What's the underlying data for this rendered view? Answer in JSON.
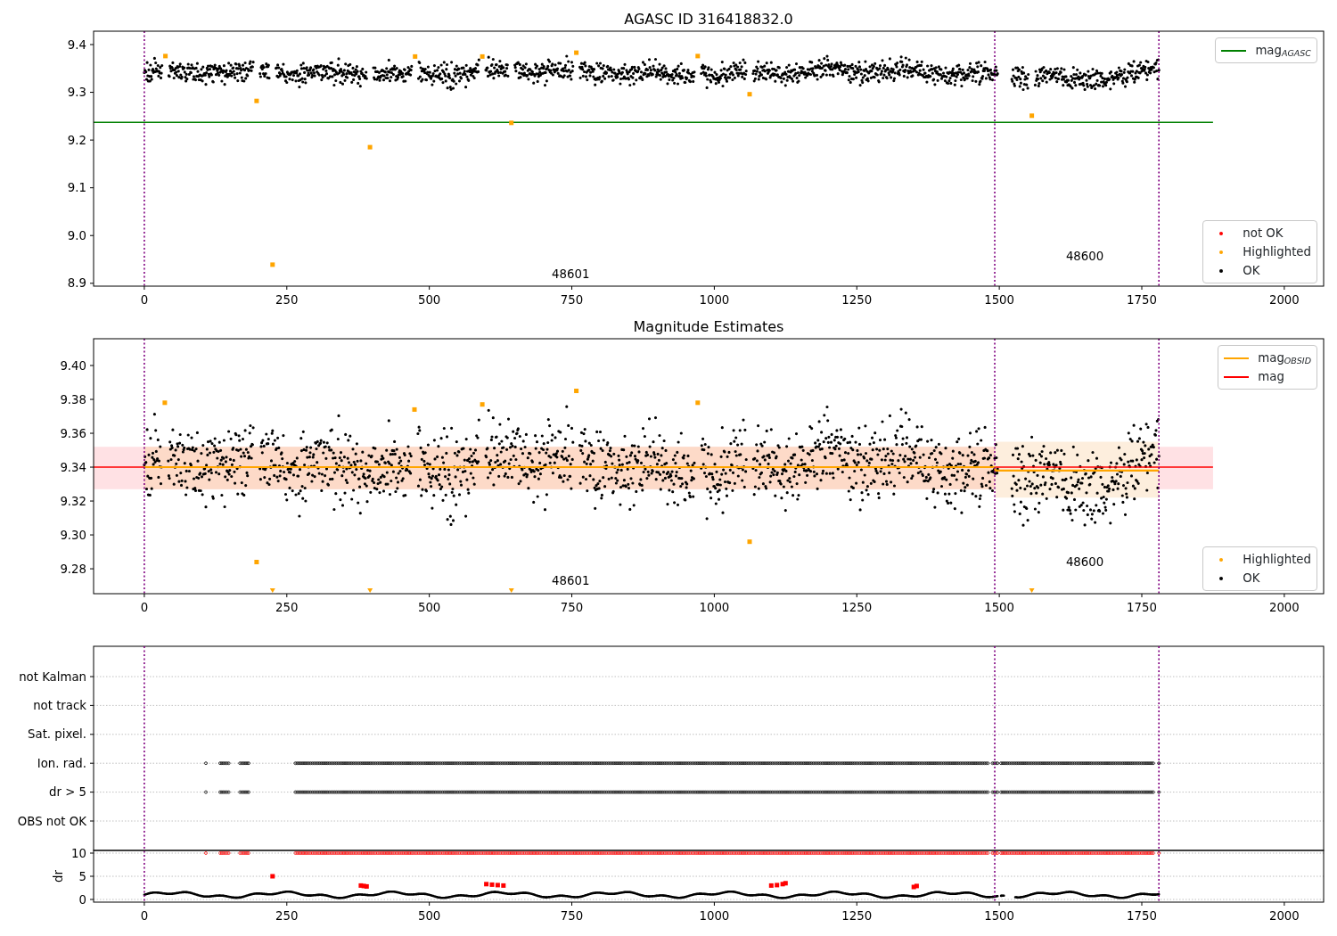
{
  "charts": [
    {
      "kind": "magnitude",
      "chart_data": {
        "type": "scatter",
        "title": "AGASC ID 316418832.0",
        "xlim": [
          -89,
          2069
        ],
        "ylim": [
          8.894,
          9.428
        ],
        "xticks": [
          0,
          250,
          500,
          750,
          1000,
          1250,
          1500,
          1750,
          2000
        ],
        "yticks": [
          {
            "value": 8.9,
            "label": "8.9"
          },
          {
            "value": 9.0,
            "label": "9.0"
          },
          {
            "value": 9.1,
            "label": "9.1"
          },
          {
            "value": 9.2,
            "label": "9.2"
          },
          {
            "value": 9.3,
            "label": "9.3"
          },
          {
            "value": 9.4,
            "label": "9.4"
          }
        ],
        "x": [
          -89,
          37,
          197,
          225,
          396,
          475,
          593,
          644,
          758,
          971,
          1062,
          1557,
          1875
        ],
        "series": [
          {
            "type": "line",
            "color": "#008000",
            "values": [
              9.237,
              9.237,
              9.237,
              9.237,
              9.237,
              9.237,
              9.237,
              9.237,
              9.237,
              9.237,
              9.237,
              9.237,
              9.237
            ]
          },
          {
            "color": "#ffa500",
            "values": [
              null,
              9.376,
              9.282,
              8.939,
              9.185,
              9.375,
              9.375,
              9.236,
              9.383,
              9.376,
              9.296,
              9.251,
              null
            ]
          }
        ],
        "ref_lines": [
          {
            "axis": "x",
            "value": 0,
            "color": "#800080"
          },
          {
            "axis": "x",
            "value": 1492,
            "color": "#800080"
          },
          {
            "axis": "x",
            "value": 1780,
            "color": "#800080"
          }
        ],
        "annotations": [
          "48601",
          "48600"
        ]
      },
      "legends": [
        {
          "entries": [
            {
              "label": "mag$_{AGASC}$",
              "kind": "line",
              "color": "#008000"
            }
          ]
        },
        {
          "entries": [
            {
              "label": "not OK",
              "kind": "dot",
              "color": "#ff0000"
            },
            {
              "label": "Highlighted",
              "kind": "dot",
              "color": "#ffa500"
            },
            {
              "label": "OK",
              "kind": "dot",
              "color": "#000000"
            }
          ]
        }
      ]
    },
    {
      "kind": "magnitude",
      "chart_data": {
        "type": "scatter",
        "title": "Magnitude Estimates",
        "xlim": [
          -89,
          2069
        ],
        "ylim": [
          9.2653,
          9.4158
        ],
        "xticks": [
          0,
          250,
          500,
          750,
          1000,
          1250,
          1500,
          1750,
          2000
        ],
        "yticks": [
          {
            "value": 9.28,
            "label": "9.28"
          },
          {
            "value": 9.3,
            "label": "9.30"
          },
          {
            "value": 9.32,
            "label": "9.32"
          },
          {
            "value": 9.34,
            "label": "9.34"
          },
          {
            "value": 9.36,
            "label": "9.36"
          },
          {
            "value": 9.38,
            "label": "9.38"
          },
          {
            "value": 9.4,
            "label": "9.40"
          }
        ],
        "bands": [
          {
            "axis": "y",
            "from": 9.327,
            "to": 9.352,
            "color": "#ffe1e4"
          },
          {
            "axis": "y",
            "from": 9.327,
            "to": 9.352,
            "color": "#fddac8"
          },
          {
            "axis": "y",
            "from": 9.322,
            "to": 9.355,
            "color": "#fdeedd"
          }
        ],
        "x": [
          -89,
          0,
          36,
          197,
          474,
          593,
          758,
          971,
          1062,
          1492,
          1493,
          1780,
          1875
        ],
        "series": [
          {
            "type": "line",
            "color": "#ff0000",
            "values": [
              9.34,
              9.34,
              null,
              null,
              null,
              null,
              null,
              null,
              null,
              9.34,
              9.34,
              9.34,
              9.34
            ]
          },
          {
            "type": "line",
            "color": "#ffa500",
            "values": [
              null,
              9.34,
              9.34,
              9.34,
              9.34,
              9.34,
              9.34,
              9.34,
              9.34,
              9.34,
              9.338,
              9.338,
              null
            ]
          },
          {
            "color": "#ffa500",
            "values": [
              null,
              null,
              9.378,
              9.284,
              9.374,
              9.377,
              9.385,
              9.378,
              9.296,
              null,
              null,
              null,
              null
            ]
          }
        ],
        "ref_lines": [
          {
            "axis": "x",
            "value": 0,
            "color": "#800080"
          },
          {
            "axis": "x",
            "value": 1492,
            "color": "#800080"
          },
          {
            "axis": "x",
            "value": 1780,
            "color": "#800080"
          }
        ],
        "annotations": [
          "48601",
          "48600"
        ]
      },
      "legends": [
        {
          "entries": [
            {
              "label": "mag$_{OBSID}$",
              "kind": "line",
              "color": "#ffa500"
            },
            {
              "label": "mag",
              "kind": "line",
              "color": "#ff0000"
            }
          ]
        },
        {
          "entries": [
            {
              "label": "Highlighted",
              "kind": "dot",
              "color": "#ffa500"
            },
            {
              "label": "OK",
              "kind": "dot",
              "color": "#000000"
            }
          ]
        }
      ]
    },
    {
      "kind": "flags",
      "row_labels": [
        "not Kalman",
        "not track",
        "Sat. pixel.",
        "Ion. rad.",
        "dr > 5",
        "OBS not OK"
      ],
      "chart_data": {
        "type": "scatter",
        "ylabel": "dr",
        "grid": true,
        "xlim": [
          -89,
          2069
        ],
        "ylim": [
          -0.58,
          10.58
        ],
        "xticks": [
          0,
          250,
          500,
          750,
          1000,
          1250,
          1500,
          1750,
          2000
        ],
        "yticks": [
          0,
          5,
          10
        ],
        "x": [
          225,
          380,
          385,
          390,
          600,
          610,
          620,
          630,
          1100,
          1110,
          1120,
          1125,
          1350,
          1355
        ],
        "series": [
          {
            "color": "#ff0000",
            "values": [
              5,
              3,
              2.9,
              2.8,
              3.3,
              3.2,
              3.1,
              3,
              3,
              3.1,
              3.3,
              3.5,
              2.7,
              2.9
            ]
          }
        ],
        "ref_lines": [
          {
            "axis": "x",
            "value": 0,
            "color": "#800080"
          },
          {
            "axis": "x",
            "value": 1492,
            "color": "#800080"
          },
          {
            "axis": "x",
            "value": 1780,
            "color": "#800080"
          }
        ]
      }
    }
  ]
}
